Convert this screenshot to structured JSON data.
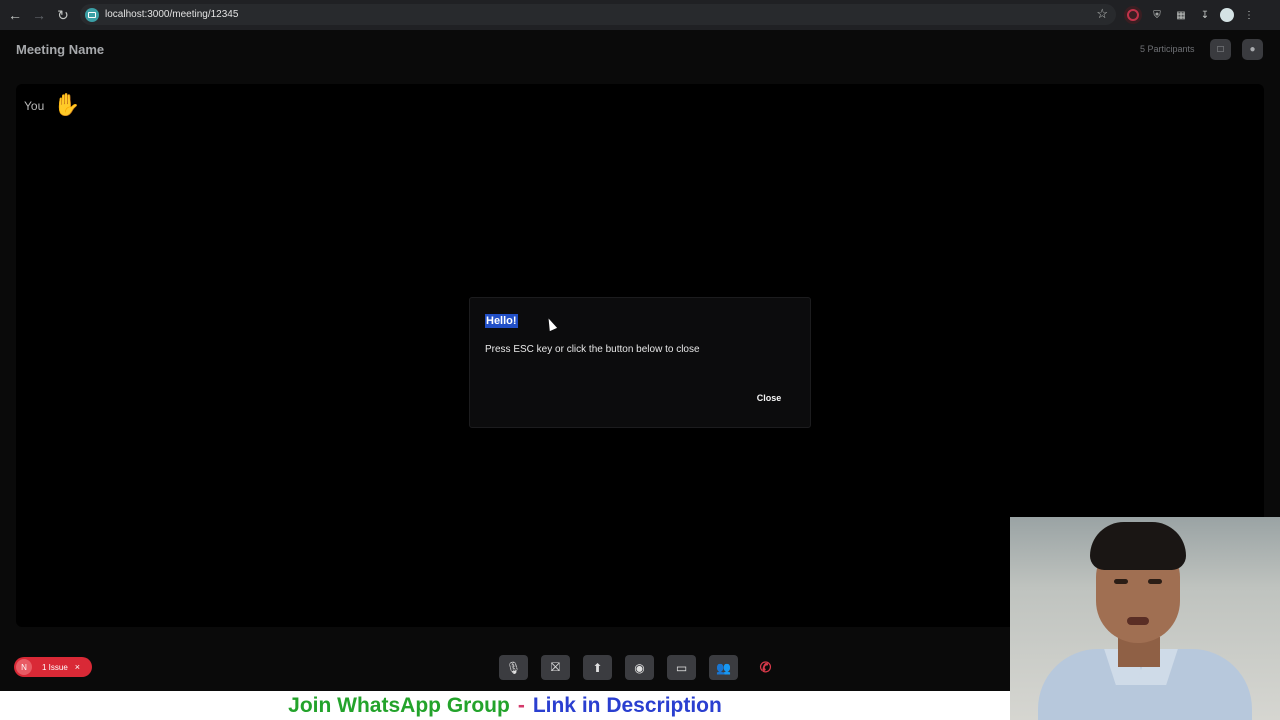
{
  "browser": {
    "url": "localhost:3000/meeting/12345",
    "back_icon": "arrow-left-icon",
    "forward_icon": "arrow-right-icon",
    "reload_icon": "reload-icon",
    "star_icon": "star-icon"
  },
  "meeting": {
    "name": "Meeting Name",
    "participants": "5 Participants",
    "chat_icon": "chat-icon",
    "people_icon": "people-icon"
  },
  "stage": {
    "local_label": "You",
    "hand_emoji": "✋"
  },
  "dialog": {
    "title": "Hello!",
    "message": "Press ESC key or click the button below to close",
    "close_label": "Close"
  },
  "issue_badge": {
    "initial": "N",
    "text": "1 Issue",
    "dismiss": "×"
  },
  "controls": [
    {
      "name": "mic-off",
      "icon": "🎙"
    },
    {
      "name": "camera-off",
      "icon": "⛝"
    },
    {
      "name": "share-screen",
      "icon": "⬆"
    },
    {
      "name": "record",
      "icon": "◉"
    },
    {
      "name": "chat",
      "icon": "▭"
    },
    {
      "name": "participants",
      "icon": "👥"
    },
    {
      "name": "leave-call",
      "icon": "✆"
    }
  ],
  "banner": {
    "part1": "Join WhatsApp Group",
    "separator": "-",
    "part2": "Link in Description"
  },
  "colors": {
    "accent_red": "#d92936",
    "banner_green": "#23a32b",
    "banner_blue": "#2a3fd0",
    "selection_blue": "#2250c7"
  }
}
